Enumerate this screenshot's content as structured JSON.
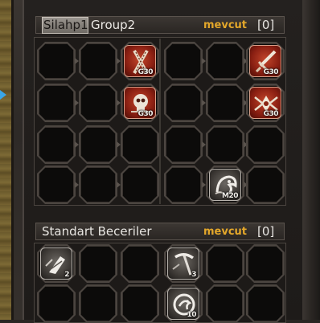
{
  "skill_window": {
    "group_tabs": {
      "active": "Silahp1",
      "inactive": "Group2"
    },
    "group_points": {
      "label": "mevcut",
      "value": "[0]"
    },
    "standard": {
      "title": "Standart Beceriler",
      "label": "mevcut",
      "value": "[0]"
    },
    "group_skills": [
      {
        "icon": "crossed-ropes-icon",
        "level": "G30",
        "style": "red"
      },
      {
        "icon": "sword-icon",
        "level": "G30",
        "style": "red"
      },
      {
        "icon": "skull-icon",
        "level": "G30",
        "style": "red"
      },
      {
        "icon": "winged-emblem-icon",
        "level": "G30",
        "style": "red"
      },
      {
        "icon": "beast-head-icon",
        "level": "M20",
        "style": "gray"
      }
    ],
    "standard_skills": [
      {
        "icon": "riding-icon",
        "level": "2",
        "style": "gray"
      },
      {
        "icon": "pickaxe-icon",
        "level": "3",
        "style": "gray"
      },
      {
        "icon": "dragon-icon",
        "level": "10",
        "style": "gray"
      }
    ]
  }
}
